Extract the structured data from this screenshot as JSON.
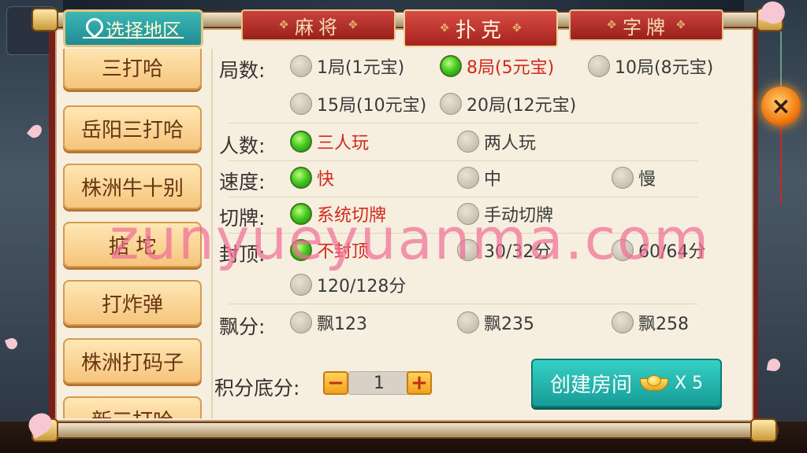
{
  "header": {
    "region_button": "选择地区",
    "tabs": [
      {
        "label": "麻将",
        "active": false
      },
      {
        "label": "扑克",
        "active": true
      },
      {
        "label": "字牌",
        "active": false
      }
    ]
  },
  "game_list": [
    "三打哈",
    "岳阳三打哈",
    "株洲牛十别",
    "掂 坨",
    "打炸弹",
    "株洲打码子",
    "新三打哈"
  ],
  "options": {
    "rounds": {
      "label": "局数:",
      "items": [
        "1局(1元宝)",
        "8局(5元宝)",
        "10局(8元宝)",
        "15局(10元宝)",
        "20局(12元宝)"
      ],
      "selected": "8局(5元宝)"
    },
    "players": {
      "label": "人数:",
      "items": [
        "三人玩",
        "两人玩"
      ],
      "selected": "三人玩"
    },
    "speed": {
      "label": "速度:",
      "items": [
        "快",
        "中",
        "慢"
      ],
      "selected": "快"
    },
    "cut": {
      "label": "切牌:",
      "items": [
        "系统切牌",
        "手动切牌"
      ],
      "selected": "系统切牌"
    },
    "cap": {
      "label": "封顶:",
      "items": [
        "不封顶",
        "30/32分",
        "60/64分",
        "120/128分"
      ],
      "selected": "不封顶"
    },
    "float": {
      "label": "飘分:",
      "items": [
        "飘123",
        "飘235",
        "飘258"
      ],
      "selected": null
    }
  },
  "base_score": {
    "label": "积分底分:",
    "value": "1",
    "minus": "−",
    "plus": "+"
  },
  "create": {
    "label": "创建房间",
    "multiplier": "X 5"
  },
  "close": "×",
  "watermark": "zunyueyuanma.com",
  "colors": {
    "accent_red": "#d4271c",
    "teal": "#1f9d97",
    "panel": "#f6efe0"
  }
}
